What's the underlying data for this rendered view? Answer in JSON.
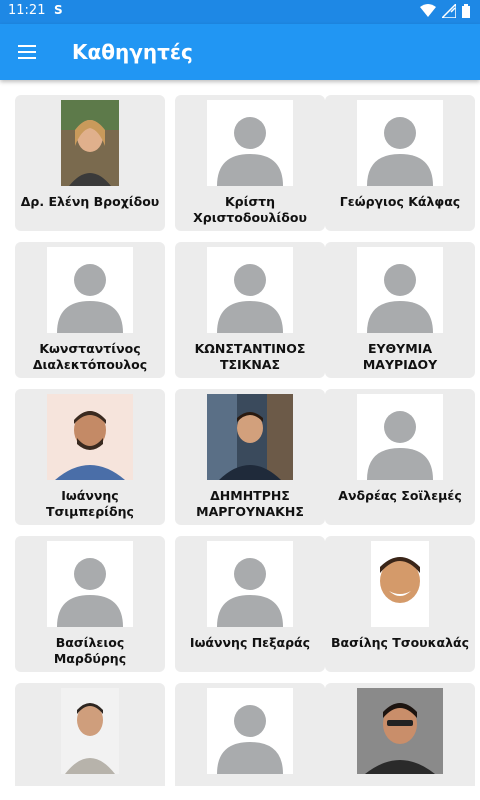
{
  "status": {
    "time": "11:21",
    "s_icon": "S"
  },
  "app": {
    "title": "Καθηγητές",
    "menu_icon": "hamburger-menu-icon"
  },
  "colors": {
    "status_bar": "#1e88e5",
    "app_bar": "#2196f3",
    "card_bg": "#ececec",
    "placeholder_bg": "#ffffff",
    "placeholder_fg": "#a9abad"
  },
  "teachers": [
    {
      "name": "Δρ. Ελένη Βροχίδου",
      "photo": "photo"
    },
    {
      "name": "Κρίστη Χριστοδουλίδου",
      "photo": "placeholder"
    },
    {
      "name": "Γεώργιος Κάλφας",
      "photo": "placeholder"
    },
    {
      "name": "Κωνσταντίνος Διαλεκτόπουλος",
      "photo": "placeholder"
    },
    {
      "name": "ΚΩΝΣΤΑΝΤΙΝΟΣ ΤΣΙΚΝΑΣ",
      "photo": "placeholder"
    },
    {
      "name": "ΕΥΘΥΜΙΑ ΜΑΥΡΙΔΟΥ",
      "photo": "placeholder"
    },
    {
      "name": "Ιωάννης Τσιμπερίδης",
      "photo": "photo"
    },
    {
      "name": "ΔΗΜΗΤΡΗΣ ΜΑΡΓΟΥΝΑΚΗΣ",
      "photo": "photo"
    },
    {
      "name": "Ανδρέας Σοϊλεμές",
      "photo": "placeholder"
    },
    {
      "name": "Βασίλειος Μαρδύρης",
      "photo": "placeholder"
    },
    {
      "name": "Ιωάννης Πεξαράς",
      "photo": "placeholder"
    },
    {
      "name": "Βασίλης Τσουκαλάς",
      "photo": "photo"
    },
    {
      "name": "",
      "photo": "photo"
    },
    {
      "name": "",
      "photo": "placeholder"
    },
    {
      "name": "",
      "photo": "photo"
    }
  ]
}
